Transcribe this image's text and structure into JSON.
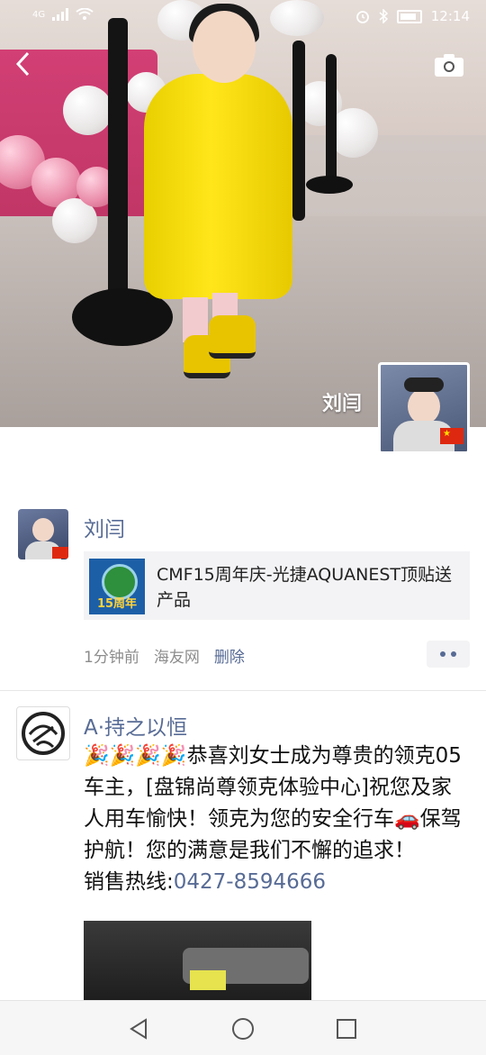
{
  "status_bar": {
    "network": "4G",
    "time": "12:14"
  },
  "header": {
    "back_icon": "chevron-left-icon",
    "camera_icon": "camera-icon",
    "cover_name": "刘闫"
  },
  "posts": [
    {
      "author": "刘闫",
      "share": {
        "thumb_text": "15周年",
        "title": "CMF15周年庆-光捷AQUANEST顶贴送产品"
      },
      "time": "1分钟前",
      "source": "海友网",
      "delete_label": "删除"
    },
    {
      "author": "A·持之以恒",
      "text_emoji": "🎉🎉🎉🎉",
      "text_main": "恭喜刘女士成为尊贵的领克05车主，[盘锦尚尊领克体验中心]祝您及家人用车愉快！领克为您的安全行车",
      "text_car": "🚗",
      "text_tail": "保驾护航！您的满意是我们不懈的追求！",
      "hotline_label": "销售热线:",
      "hotline_number": "0427-8594666"
    }
  ],
  "nav": {
    "back": "triangle-back-icon",
    "home": "circle-home-icon",
    "recent": "square-recent-icon"
  }
}
